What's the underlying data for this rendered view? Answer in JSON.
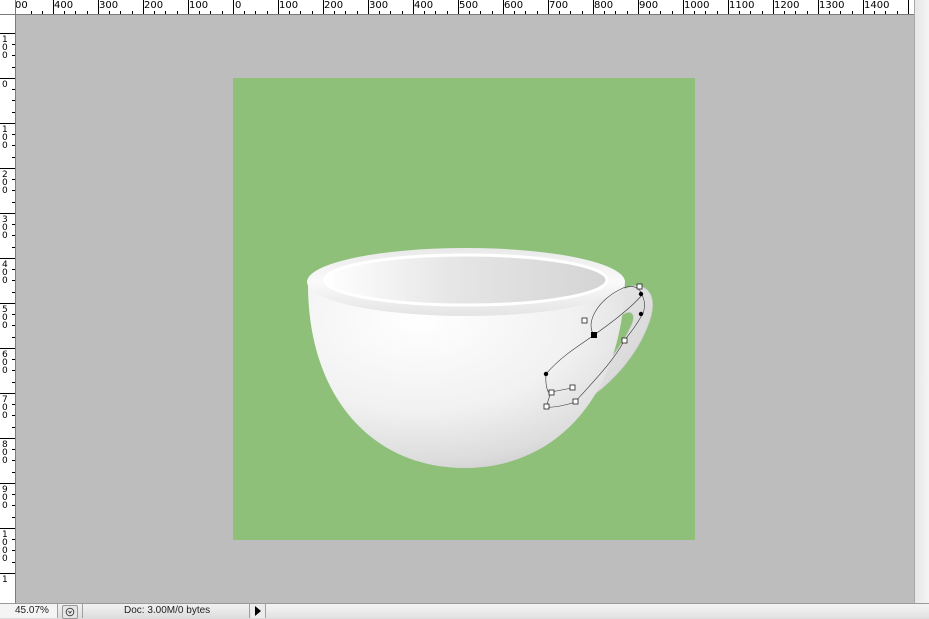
{
  "rulers": {
    "horizontal_labels": [
      "00",
      "400",
      "300",
      "200",
      "100",
      "0",
      "100",
      "200",
      "300",
      "400",
      "500",
      "600",
      "700",
      "800",
      "900",
      "1000",
      "1100",
      "1200",
      "1300",
      "1400"
    ],
    "vertical_labels": [
      "100",
      "0",
      "100",
      "200",
      "300",
      "400",
      "500",
      "600",
      "700",
      "800",
      "900",
      "1000",
      "1"
    ]
  },
  "canvas": {
    "pasteboard_color": "#bdbdbd",
    "document_color": "#8ec07a",
    "artwork": "white-teacup-with-handle-path-selected",
    "path_anchor_icons": "anchor-point-icon"
  },
  "status_bar": {
    "zoom": "45.07%",
    "doc_info": "Doc: 3.00M/0 bytes",
    "popup_icon": "status-popup-icon",
    "arrow_icon": "play-arrow-icon"
  }
}
